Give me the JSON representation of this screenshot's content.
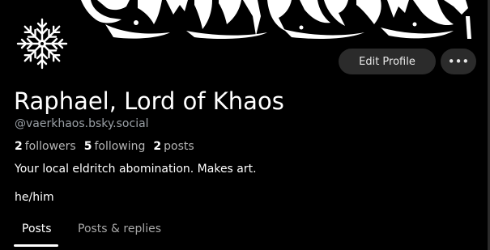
{
  "profile": {
    "display_name": "Raphael, Lord of Khaos",
    "handle": "@vaerkhaos.bsky.social",
    "bio": "Your local eldritch abomination. Makes art.",
    "pronouns": "he/him",
    "avatar_icon": "snowflake-sigil-icon",
    "banner_icon": "gothic-blackletter-banner"
  },
  "stats": {
    "followers_count": "2",
    "followers_label": "followers",
    "following_count": "5",
    "following_label": "following",
    "posts_count": "2",
    "posts_label": "posts"
  },
  "actions": {
    "edit_profile_label": "Edit Profile",
    "more_label": "•••",
    "more_icon": "ellipsis-icon"
  },
  "tabs": [
    {
      "label": "Posts",
      "active": true
    },
    {
      "label": "Posts & replies",
      "active": false
    }
  ],
  "colors": {
    "background": "#000000",
    "button_bg": "#2b2b2b",
    "muted_text": "#9aa0a6"
  }
}
